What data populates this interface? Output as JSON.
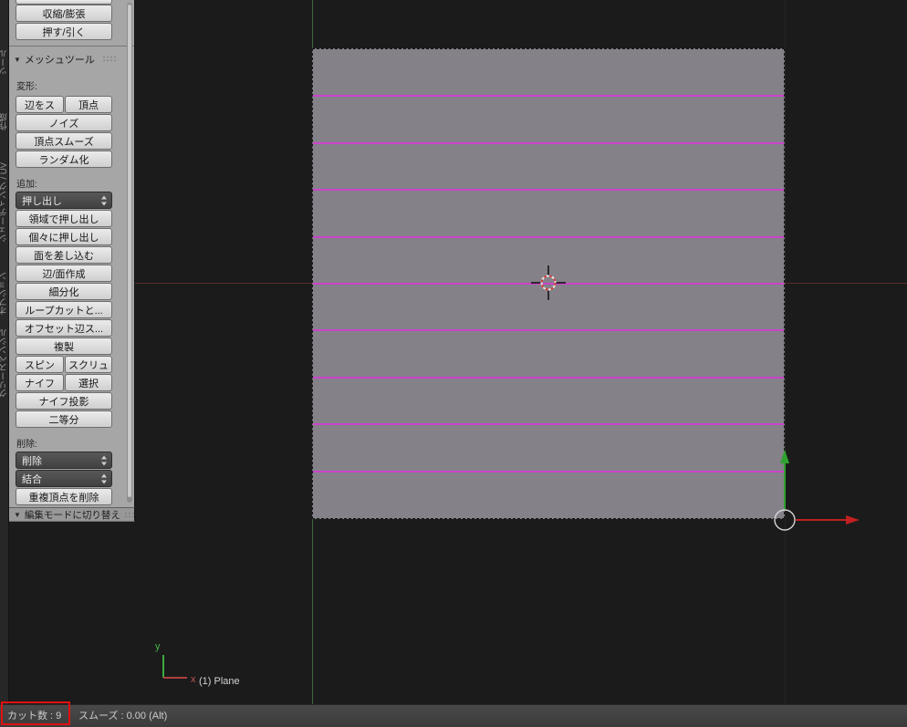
{
  "tab_strip": {
    "tabs": [
      "ツール",
      "作成",
      "シェーディング / UV",
      "オプション",
      "グリースペンシル"
    ]
  },
  "icons": {
    "collapse": "▼"
  },
  "tool_shelf": {
    "partial_top": {
      "shrink_fatten": "収縮/膨張",
      "push_pull": "押す/引く"
    },
    "mesh_panel": {
      "header": "メッシュツール",
      "deform_label": "変形:",
      "b_edge_slide": "辺をス",
      "b_vert_slide": "頂点",
      "b_noise": "ノイズ",
      "b_vertex_smooth": "頂点スムーズ",
      "b_randomize": "ランダム化",
      "add_label": "追加:",
      "dd_extrude": "押し出し",
      "b_extrude_region": "領域で押し出し",
      "b_extrude_indiv": "個々に押し出し",
      "b_inset_faces": "面を差し込む",
      "b_edge_face": "辺/面作成",
      "b_subdivide": "細分化",
      "b_loopcut": "ループカットと...",
      "b_offset_edge": "オフセット辺ス...",
      "b_duplicate": "複製",
      "b_spin": "スピン",
      "b_screw": "スクリュ",
      "b_knife": "ナイフ",
      "b_select": "選択",
      "b_knife_project": "ナイフ投影",
      "b_bisect": "二等分",
      "delete_label": "削除:",
      "dd_delete": "削除",
      "dd_merge": "結合",
      "b_remove_doubles": "重複頂点を削除"
    },
    "bottom_panel_header": "編集モードに切り替え"
  },
  "viewport": {
    "object_info": "(1) Plane",
    "axis_x_label": "x",
    "axis_y_label": "y",
    "loopcut": {
      "count": 9,
      "color": "#cb43cb"
    },
    "colors": {
      "background": "#1b1b1b",
      "plane": "#848189",
      "x_axis": "#5d2b2b",
      "y_axis": "#3e663e",
      "grid": "#262626"
    }
  },
  "status_bar": {
    "cut_count": "カット数 : 9",
    "smooth": "スムーズ : 0.00 (Alt)"
  },
  "annotation": {
    "highlight_color": "#e01010"
  }
}
